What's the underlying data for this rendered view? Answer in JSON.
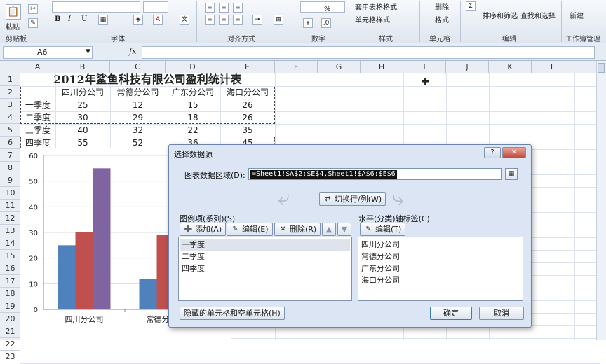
{
  "ribbon": {
    "groups": [
      {
        "label": "剪贴板"
      },
      {
        "label": "字体"
      },
      {
        "label": "对齐方式"
      },
      {
        "label": "数字"
      },
      {
        "label": "样式"
      },
      {
        "label": "单元格"
      },
      {
        "label": "编辑"
      },
      {
        "label": "工作簿管理"
      }
    ],
    "paste_label": "粘贴",
    "bold": "B",
    "italic": "I",
    "underline": "U",
    "percent": "%",
    "table_format": "套用表格格式",
    "cell_style": "单元格样式",
    "delete": "删除",
    "format": "格式",
    "sort_filter": "排序和筛选",
    "find_select": "查找和选择",
    "new": "新建"
  },
  "formula_bar": {
    "name_box": "A6",
    "fx": "fx",
    "formula": ""
  },
  "columns": [
    "A",
    "B",
    "C",
    "D",
    "E",
    "F",
    "G",
    "H",
    "I",
    "J",
    "K",
    "L"
  ],
  "rows": [
    "1",
    "2",
    "3",
    "4",
    "5",
    "6",
    "7",
    "8",
    "9",
    "10",
    "11",
    "12",
    "13",
    "14",
    "15",
    "16",
    "17",
    "18",
    "19",
    "20",
    "21",
    "22",
    "23"
  ],
  "sheet": {
    "title": "2012年鲨鱼科技有限公司盈利统计表",
    "headers": [
      "四川分公司",
      "常德分公司",
      "广东分公司",
      "海口分公司"
    ],
    "data": [
      {
        "quarter": "一季度",
        "values": [
          "25",
          "12",
          "15",
          "26"
        ]
      },
      {
        "quarter": "二季度",
        "values": [
          "30",
          "29",
          "18",
          "26"
        ]
      },
      {
        "quarter": "三季度",
        "values": [
          "40",
          "32",
          "22",
          "35"
        ]
      },
      {
        "quarter": "四季度",
        "values": [
          "55",
          "52",
          "36",
          "45"
        ]
      }
    ]
  },
  "chart_data": {
    "type": "bar",
    "categories": [
      "四川分公司",
      "常德分公司"
    ],
    "series": [
      {
        "values": [
          25,
          12
        ],
        "color": "#4f81bd"
      },
      {
        "values": [
          30,
          29
        ],
        "color": "#c0504d"
      },
      {
        "values": [
          55,
          null
        ],
        "color": "#8064a2"
      }
    ],
    "ylim": [
      0,
      60
    ],
    "yticks": [
      "0",
      "10",
      "20",
      "30",
      "40",
      "50",
      "60"
    ],
    "grid": true
  },
  "dialog": {
    "title": "选择数据源",
    "help": "?",
    "close": "✕",
    "range_label": "图表数据区域(D):",
    "range_value": "=Sheet1!$A$2:$E$4,Sheet1!$A$6:$E$6",
    "switch_label": "切换行/列(W)",
    "legend_label": "图例项(系列)(S)",
    "add_label": "添加(A)",
    "edit_label": "编辑(E)",
    "remove_label": "删除(R)",
    "series_items": [
      "一季度",
      "二季度",
      "四季度"
    ],
    "axis_label": "水平(分类)轴标签(C)",
    "axis_edit_label": "编辑(T)",
    "axis_items": [
      "四川分公司",
      "常德分公司",
      "广东分公司",
      "海口分公司"
    ],
    "hidden_cells_label": "隐藏的单元格和空单元格(H)",
    "ok_label": "确定",
    "cancel_label": "取消"
  }
}
